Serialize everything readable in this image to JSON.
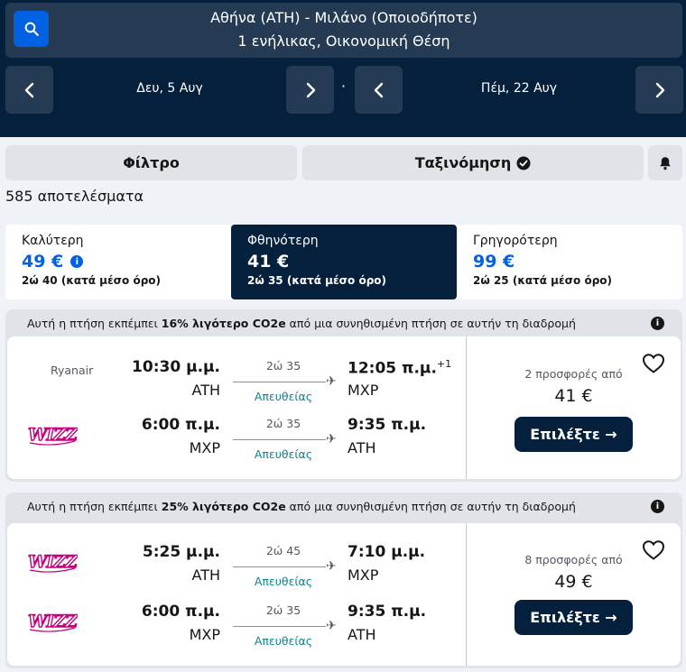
{
  "header": {
    "route_line1": "Αθήνα (ATH) - Μιλάνο (Οποιοδήποτε)",
    "route_line2": "1 ενήλικας, Οικονομική Θέση",
    "depart_date": "Δευ, 5 Αυγ",
    "return_date": "Πέμ, 22 Αυγ",
    "separator": "·",
    "icons": [
      "search-icon",
      "chevron-left-icon",
      "chevron-right-icon"
    ]
  },
  "toolbar": {
    "filter_label": "Φίλτρο",
    "sort_label": "Ταξινόμηση",
    "results_count": "585 αποτελέσματα"
  },
  "sort_tabs": [
    {
      "title": "Καλύτερη",
      "price": "49 €",
      "duration": "2ώ 40 (κατά μέσο όρο)"
    },
    {
      "title": "Φθηνότερη",
      "price": "41 €",
      "duration": "2ώ 35 (κατά μέσο όρο)"
    },
    {
      "title": "Γρηγορότερη",
      "price": "99 €",
      "duration": "2ώ 25 (κατά μέσο όρο)"
    }
  ],
  "info_char": "i",
  "cards": [
    {
      "eco_prefix": "Αυτή η πτήση εκπέμπει ",
      "eco_bold": "16% λιγότερο CO2e",
      "eco_suffix": " από μια συνηθισμένη πτήση σε αυτήν τη διαδρομή",
      "legs": [
        {
          "airline": "Ryanair",
          "dep_time": "10:30 μ.μ.",
          "dep_code": "ATH",
          "duration": "2ώ 35",
          "stops": "Απευθείας",
          "arr_time": "12:05 π.μ.",
          "arr_plus": "+1",
          "arr_code": "MXP"
        },
        {
          "airline": "WIZZ",
          "dep_time": "6:00 π.μ.",
          "dep_code": "MXP",
          "duration": "2ώ 35",
          "stops": "Απευθείας",
          "arr_time": "9:35 π.μ.",
          "arr_plus": "",
          "arr_code": "ATH"
        }
      ],
      "offers": "2 προσφορές από",
      "price": "41 €",
      "select_label": "Επιλέξτε →"
    },
    {
      "eco_prefix": "Αυτή η πτήση εκπέμπει ",
      "eco_bold": "25% λιγότερο CO2e",
      "eco_suffix": " από μια συνηθισμένη πτήση σε αυτήν τη διαδρομή",
      "legs": [
        {
          "airline": "WIZZ",
          "dep_time": "5:25 μ.μ.",
          "dep_code": "ATH",
          "duration": "2ώ 45",
          "stops": "Απευθείας",
          "arr_time": "7:10 μ.μ.",
          "arr_plus": "",
          "arr_code": "MXP"
        },
        {
          "airline": "WIZZ",
          "dep_time": "6:00 π.μ.",
          "dep_code": "MXP",
          "duration": "2ώ 35",
          "stops": "Απευθείας",
          "arr_time": "9:35 π.μ.",
          "arr_plus": "",
          "arr_code": "ATH"
        }
      ],
      "offers": "8 προσφορές από",
      "price": "49 €",
      "select_label": "Επιλέξτε →"
    }
  ],
  "colors": {
    "navy": "#05203c",
    "blue": "#0062e3",
    "teal": "#0c838a",
    "wizz": "#c6007e"
  }
}
